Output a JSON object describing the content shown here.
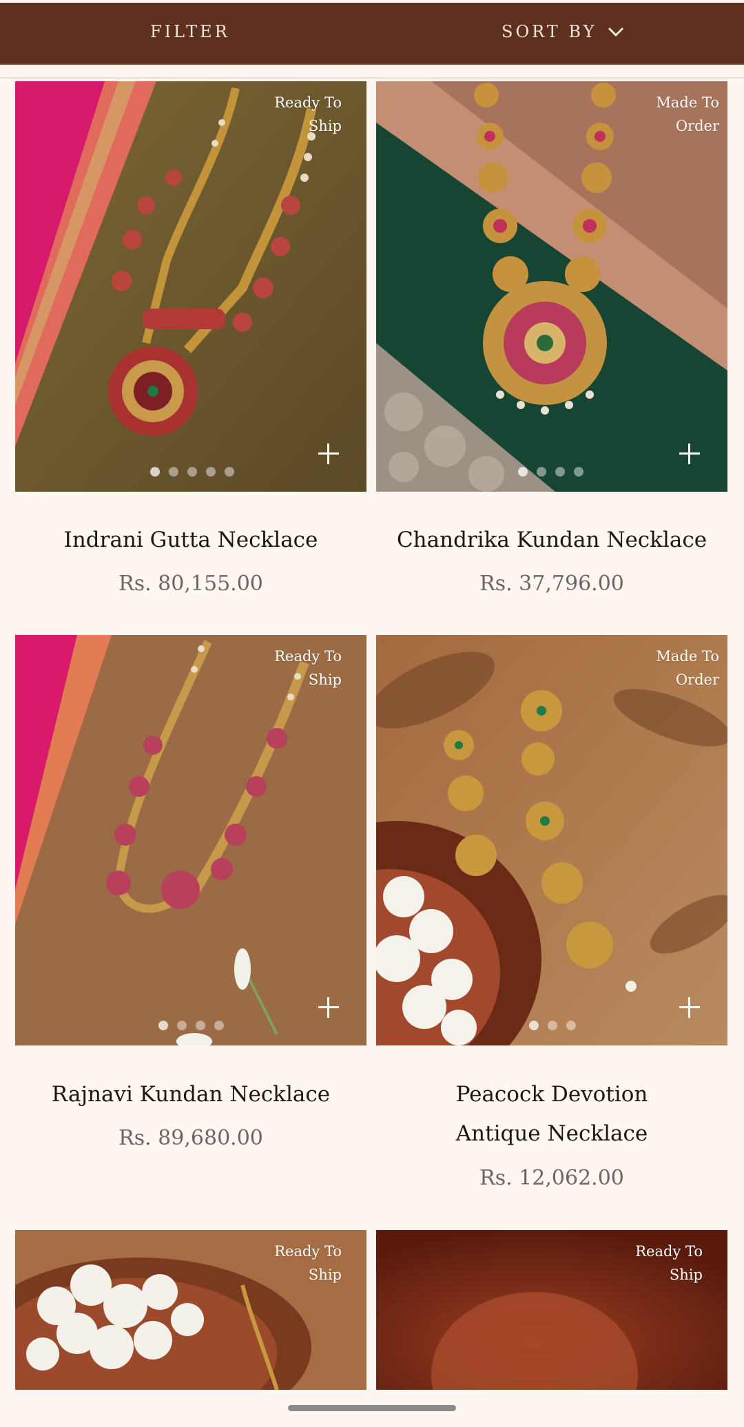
{
  "toolbar": {
    "filter_label": "FILTER",
    "sort_label": "SORT BY"
  },
  "products": [
    {
      "name": "Indrani Gutta Necklace",
      "price": "Rs. 80,155.00",
      "badge": "Ready To Ship",
      "image_count": 5,
      "active_image": 1
    },
    {
      "name": "Chandrika Kundan Necklace",
      "price": "Rs. 37,796.00",
      "badge": "Made To Order",
      "image_count": 4,
      "active_image": 1
    },
    {
      "name": "Rajnavi Kundan Necklace",
      "price": "Rs. 89,680.00",
      "badge": "Ready To Ship",
      "image_count": 4,
      "active_image": 1
    },
    {
      "name": "Peacock Devotion Antique Necklace",
      "price": "Rs. 12,062.00",
      "badge": "Made To Order",
      "image_count": 3,
      "active_image": 1
    },
    {
      "name": "",
      "price": "",
      "badge": "Ready To Ship"
    },
    {
      "name": "",
      "price": "",
      "badge": "Ready To Ship"
    }
  ],
  "colors": {
    "topbar": "#5e3020",
    "background": "#fdf6f1",
    "title": "#1f1512",
    "price": "#6b6464"
  },
  "icons": {
    "sort": "chevron-down-icon",
    "add": "plus-icon"
  }
}
